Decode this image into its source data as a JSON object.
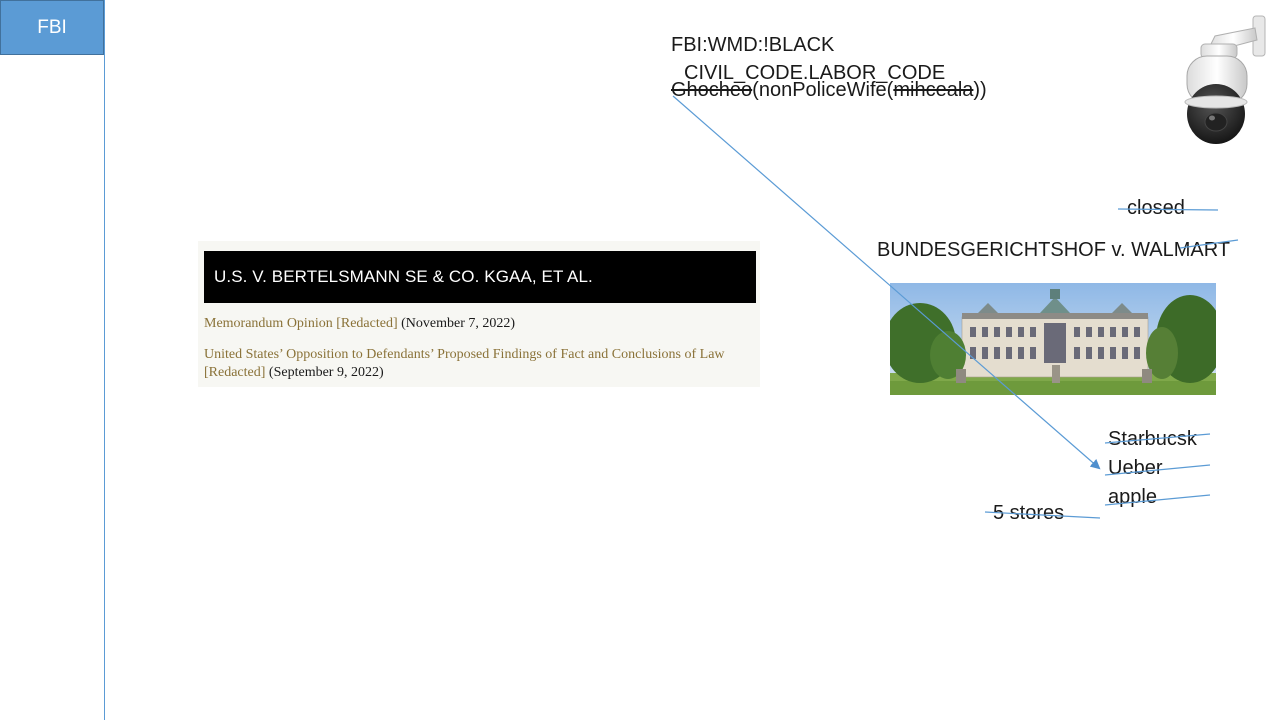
{
  "sidebar": {
    "tab_label": "FBI"
  },
  "notes": {
    "line1": "FBI:WMD:!BLACK",
    "line2": "CIVIL_CODE.LABOR_CODE",
    "line3": {
      "struck_name": "Ghocheo",
      "middle": "(nonPoliceWife(",
      "struck_inner": "mihceala",
      "closing": "))"
    }
  },
  "case_card": {
    "title": "U.S. V. BERTELSMANN SE & CO. KGAA, ET AL.",
    "documents": [
      {
        "link": "Memorandum Opinion [Redacted]",
        "date": "(November 7, 2022)"
      },
      {
        "link": "United States’ Opposition to Defendants’ Proposed Findings of Fact and Conclusions of Law [Redacted]",
        "date": "(September 9, 2022)"
      }
    ]
  },
  "status_label": "closed",
  "case_label": "BUNDESGERICHTSHOF v. WALMART",
  "stores": [
    "Starbucsk",
    "Ueber",
    "apple"
  ],
  "stores_count": "5 stores",
  "colors": {
    "accent_blue": "#5b9bd5",
    "link_gold": "#8a7238",
    "header_black": "#000000"
  },
  "icons": {
    "camera": "security-camera-icon",
    "building": "court-building-image"
  }
}
